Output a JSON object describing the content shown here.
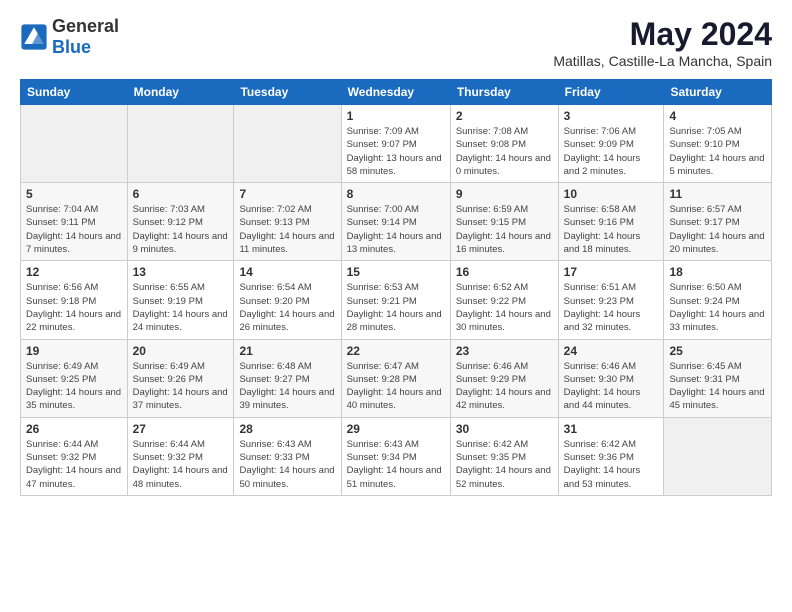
{
  "header": {
    "logo_general": "General",
    "logo_blue": "Blue",
    "title": "May 2024",
    "location": "Matillas, Castille-La Mancha, Spain"
  },
  "weekdays": [
    "Sunday",
    "Monday",
    "Tuesday",
    "Wednesday",
    "Thursday",
    "Friday",
    "Saturday"
  ],
  "weeks": [
    [
      {
        "day": "",
        "sunrise": "",
        "sunset": "",
        "daylight": ""
      },
      {
        "day": "",
        "sunrise": "",
        "sunset": "",
        "daylight": ""
      },
      {
        "day": "",
        "sunrise": "",
        "sunset": "",
        "daylight": ""
      },
      {
        "day": "1",
        "sunrise": "Sunrise: 7:09 AM",
        "sunset": "Sunset: 9:07 PM",
        "daylight": "Daylight: 13 hours and 58 minutes."
      },
      {
        "day": "2",
        "sunrise": "Sunrise: 7:08 AM",
        "sunset": "Sunset: 9:08 PM",
        "daylight": "Daylight: 14 hours and 0 minutes."
      },
      {
        "day": "3",
        "sunrise": "Sunrise: 7:06 AM",
        "sunset": "Sunset: 9:09 PM",
        "daylight": "Daylight: 14 hours and 2 minutes."
      },
      {
        "day": "4",
        "sunrise": "Sunrise: 7:05 AM",
        "sunset": "Sunset: 9:10 PM",
        "daylight": "Daylight: 14 hours and 5 minutes."
      }
    ],
    [
      {
        "day": "5",
        "sunrise": "Sunrise: 7:04 AM",
        "sunset": "Sunset: 9:11 PM",
        "daylight": "Daylight: 14 hours and 7 minutes."
      },
      {
        "day": "6",
        "sunrise": "Sunrise: 7:03 AM",
        "sunset": "Sunset: 9:12 PM",
        "daylight": "Daylight: 14 hours and 9 minutes."
      },
      {
        "day": "7",
        "sunrise": "Sunrise: 7:02 AM",
        "sunset": "Sunset: 9:13 PM",
        "daylight": "Daylight: 14 hours and 11 minutes."
      },
      {
        "day": "8",
        "sunrise": "Sunrise: 7:00 AM",
        "sunset": "Sunset: 9:14 PM",
        "daylight": "Daylight: 14 hours and 13 minutes."
      },
      {
        "day": "9",
        "sunrise": "Sunrise: 6:59 AM",
        "sunset": "Sunset: 9:15 PM",
        "daylight": "Daylight: 14 hours and 16 minutes."
      },
      {
        "day": "10",
        "sunrise": "Sunrise: 6:58 AM",
        "sunset": "Sunset: 9:16 PM",
        "daylight": "Daylight: 14 hours and 18 minutes."
      },
      {
        "day": "11",
        "sunrise": "Sunrise: 6:57 AM",
        "sunset": "Sunset: 9:17 PM",
        "daylight": "Daylight: 14 hours and 20 minutes."
      }
    ],
    [
      {
        "day": "12",
        "sunrise": "Sunrise: 6:56 AM",
        "sunset": "Sunset: 9:18 PM",
        "daylight": "Daylight: 14 hours and 22 minutes."
      },
      {
        "day": "13",
        "sunrise": "Sunrise: 6:55 AM",
        "sunset": "Sunset: 9:19 PM",
        "daylight": "Daylight: 14 hours and 24 minutes."
      },
      {
        "day": "14",
        "sunrise": "Sunrise: 6:54 AM",
        "sunset": "Sunset: 9:20 PM",
        "daylight": "Daylight: 14 hours and 26 minutes."
      },
      {
        "day": "15",
        "sunrise": "Sunrise: 6:53 AM",
        "sunset": "Sunset: 9:21 PM",
        "daylight": "Daylight: 14 hours and 28 minutes."
      },
      {
        "day": "16",
        "sunrise": "Sunrise: 6:52 AM",
        "sunset": "Sunset: 9:22 PM",
        "daylight": "Daylight: 14 hours and 30 minutes."
      },
      {
        "day": "17",
        "sunrise": "Sunrise: 6:51 AM",
        "sunset": "Sunset: 9:23 PM",
        "daylight": "Daylight: 14 hours and 32 minutes."
      },
      {
        "day": "18",
        "sunrise": "Sunrise: 6:50 AM",
        "sunset": "Sunset: 9:24 PM",
        "daylight": "Daylight: 14 hours and 33 minutes."
      }
    ],
    [
      {
        "day": "19",
        "sunrise": "Sunrise: 6:49 AM",
        "sunset": "Sunset: 9:25 PM",
        "daylight": "Daylight: 14 hours and 35 minutes."
      },
      {
        "day": "20",
        "sunrise": "Sunrise: 6:49 AM",
        "sunset": "Sunset: 9:26 PM",
        "daylight": "Daylight: 14 hours and 37 minutes."
      },
      {
        "day": "21",
        "sunrise": "Sunrise: 6:48 AM",
        "sunset": "Sunset: 9:27 PM",
        "daylight": "Daylight: 14 hours and 39 minutes."
      },
      {
        "day": "22",
        "sunrise": "Sunrise: 6:47 AM",
        "sunset": "Sunset: 9:28 PM",
        "daylight": "Daylight: 14 hours and 40 minutes."
      },
      {
        "day": "23",
        "sunrise": "Sunrise: 6:46 AM",
        "sunset": "Sunset: 9:29 PM",
        "daylight": "Daylight: 14 hours and 42 minutes."
      },
      {
        "day": "24",
        "sunrise": "Sunrise: 6:46 AM",
        "sunset": "Sunset: 9:30 PM",
        "daylight": "Daylight: 14 hours and 44 minutes."
      },
      {
        "day": "25",
        "sunrise": "Sunrise: 6:45 AM",
        "sunset": "Sunset: 9:31 PM",
        "daylight": "Daylight: 14 hours and 45 minutes."
      }
    ],
    [
      {
        "day": "26",
        "sunrise": "Sunrise: 6:44 AM",
        "sunset": "Sunset: 9:32 PM",
        "daylight": "Daylight: 14 hours and 47 minutes."
      },
      {
        "day": "27",
        "sunrise": "Sunrise: 6:44 AM",
        "sunset": "Sunset: 9:32 PM",
        "daylight": "Daylight: 14 hours and 48 minutes."
      },
      {
        "day": "28",
        "sunrise": "Sunrise: 6:43 AM",
        "sunset": "Sunset: 9:33 PM",
        "daylight": "Daylight: 14 hours and 50 minutes."
      },
      {
        "day": "29",
        "sunrise": "Sunrise: 6:43 AM",
        "sunset": "Sunset: 9:34 PM",
        "daylight": "Daylight: 14 hours and 51 minutes."
      },
      {
        "day": "30",
        "sunrise": "Sunrise: 6:42 AM",
        "sunset": "Sunset: 9:35 PM",
        "daylight": "Daylight: 14 hours and 52 minutes."
      },
      {
        "day": "31",
        "sunrise": "Sunrise: 6:42 AM",
        "sunset": "Sunset: 9:36 PM",
        "daylight": "Daylight: 14 hours and 53 minutes."
      },
      {
        "day": "",
        "sunrise": "",
        "sunset": "",
        "daylight": ""
      }
    ]
  ]
}
